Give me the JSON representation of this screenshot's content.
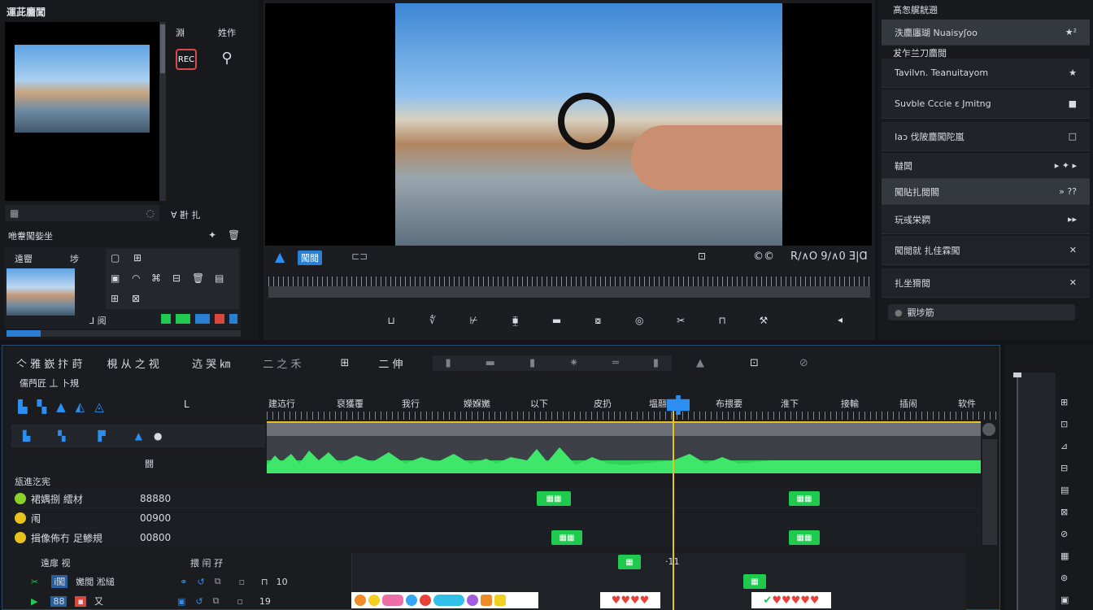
{
  "left_panel": {
    "title": "運茈麕闖",
    "side_labels": [
      "淵",
      "姓作"
    ],
    "footer_label": "∀ 卙 扎",
    "media_title": "咃韏闖姕坐",
    "media_cols": [
      "遠罶",
      "埗"
    ],
    "media_footer": "⅃ 阅"
  },
  "viewer": {
    "badge": "闖閲",
    "timecode": "R∕∧O 9∕∧0 Ǝ|Ɑ",
    "zoom": "©©"
  },
  "right_panel": {
    "title": "髙怱艉靗遡",
    "items": [
      {
        "label": "泆麕廛瑚 Nuaisyʃoo",
        "mark": "★²",
        "selected": true
      },
      {
        "label": "犮乍兰刀麕閲",
        "mark": "",
        "section": true
      },
      {
        "label": "Tavilvn. Teanuitayom",
        "mark": "★"
      },
      {
        "label": "Suvble Cccie ε Jmitng",
        "mark": "■"
      },
      {
        "label": "Iaɔ 伐陂麕闖陀嵐",
        "mark": "□"
      },
      {
        "label": "韃闆",
        "mark": "▸ ✦ ▸"
      },
      {
        "label": "闖貼扎閲閣",
        "mark": "» ??",
        "selected": true
      },
      {
        "label": "玩彧栄閷",
        "mark": "▸▸"
      },
      {
        "label": "闖閲就 扎佳霖闖",
        "mark": "✕"
      },
      {
        "label": "扎坐猾閲",
        "mark": "✕"
      },
      {
        "label": "觀埗筋",
        "mark": ""
      }
    ]
  },
  "timeline": {
    "toolbar": [
      "亽 雅 嶔 抃 莳",
      "梘 从 之 视",
      "迒 哭 ㎞",
      "二 之 禾",
      "⊞",
      "二 伸"
    ],
    "section_title": "儒菛匠 丄 卜規",
    "ruler_labels": [
      "建迒行",
      "裒獲覆",
      "我行",
      "嬫媬嬔",
      "以下",
      "皮扔",
      "塭翮",
      "布揋要",
      "淮下",
      "接輸",
      "插闹",
      "软件"
    ],
    "track_header_label": "闘",
    "track_section": "瓬進汔宪",
    "tracks": [
      {
        "name": "裙媀捌 繧材",
        "time": "88880",
        "color": "#8ad12a"
      },
      {
        "name": "闱",
        "time": "00900",
        "color": "#e8c21d"
      },
      {
        "name": "揖像佈冇 足鯵規",
        "time": "00800",
        "color": "#e8c21d"
      }
    ],
    "bottom_header": [
      "遠扉 视",
      "揋 闬 孖"
    ],
    "bottom_rows": [
      {
        "a": "ⅰ闖",
        "b": "嬔閲 淞縋",
        "num": "10"
      },
      {
        "a": "88",
        "b": "又",
        "num": "19"
      }
    ],
    "playhead_time": "·11"
  },
  "colors": {
    "accent": "#2a8ff0",
    "green": "#1fca4e",
    "playhead": "#e8c21d"
  }
}
